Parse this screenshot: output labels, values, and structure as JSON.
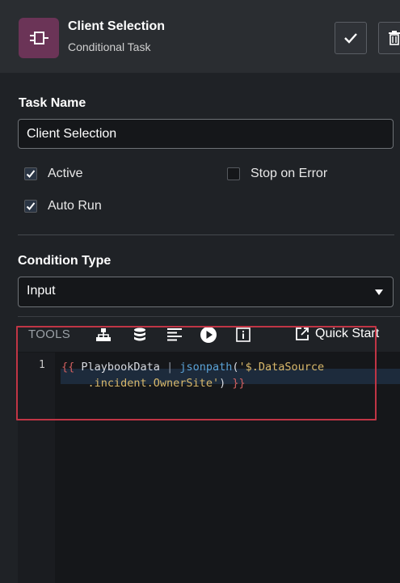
{
  "header": {
    "title": "Client Selection",
    "subtitle": "Conditional Task",
    "app_icon": "plug-icon",
    "confirm_icon": "check-icon",
    "delete_icon": "trash-icon"
  },
  "form": {
    "task_name_label": "Task Name",
    "task_name_value": "Client Selection",
    "checkboxes": {
      "active": {
        "label": "Active",
        "checked": true
      },
      "stop_on_error": {
        "label": "Stop on Error",
        "checked": false
      },
      "auto_run": {
        "label": "Auto Run",
        "checked": true
      }
    },
    "condition_type_label": "Condition Type",
    "condition_type_value": "Input"
  },
  "editor": {
    "tools_label": "TOOLS",
    "toolbar_icons": [
      "sitemap-icon",
      "database-icon",
      "align-left-icon",
      "play-icon",
      "info-icon"
    ],
    "quick_start_label": "Quick Start",
    "line_number": "1",
    "code": {
      "open": "{{",
      "var": " PlaybookData ",
      "pipe": "|",
      "fn": " jsonpath",
      "paren_open": "(",
      "str_part1": "'$.DataSource",
      "str_part2": ".incident.OwnerSite'",
      "paren_close": ")",
      "close": " }}"
    }
  },
  "colors": {
    "background": "#1f2226",
    "app_icon_bg": "#6b3457",
    "callout_border": "#c03545",
    "code_function": "#5aa2d6",
    "code_string": "#d9b86a",
    "code_brace": "#d05f5f"
  }
}
